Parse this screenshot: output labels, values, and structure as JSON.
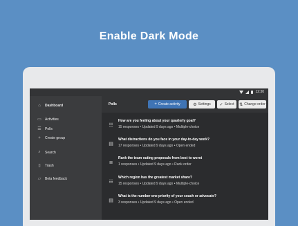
{
  "headline": "Enable Dark Mode",
  "status_bar": {
    "time": "12:30"
  },
  "sidebar": {
    "items": [
      {
        "label": "Dashboard",
        "icon": "home-icon"
      },
      {
        "label": "Activities",
        "icon": "folder-icon"
      },
      {
        "label": "Polls",
        "icon": "polls-icon"
      },
      {
        "label": "Create group",
        "icon": "plus-icon"
      },
      {
        "label": "Search",
        "icon": "search-icon"
      },
      {
        "label": "Trash",
        "icon": "trash-icon"
      },
      {
        "label": "Beta feedback",
        "icon": "feedback-icon"
      }
    ]
  },
  "toolbar": {
    "title": "Polls",
    "create_label": "Create activity",
    "settings_label": "Settings",
    "select_label": "Select",
    "change_order_label": "Change order"
  },
  "polls": [
    {
      "title": "How are you feeling about your quarterly goal?",
      "responses": "15 responses",
      "updated": "Updated 9 days ago",
      "type": "Multiple-choice",
      "icon": "multiple-choice-icon"
    },
    {
      "title": "What distractions do you face in your day-to-day work?",
      "responses": "17 responses",
      "updated": "Updated 9 days ago",
      "type": "Open ended",
      "icon": "open-ended-icon"
    },
    {
      "title": "Rank the team outing proposals from best to worst",
      "responses": "1 responses",
      "updated": "Updated 9 days ago",
      "type": "Rank order",
      "icon": "rank-order-icon"
    },
    {
      "title": "Which region has the greatest market share?",
      "responses": "15 responses",
      "updated": "Updated 9 days ago",
      "type": "Multiple-choice",
      "icon": "multiple-choice-icon"
    },
    {
      "title": "What is the number one priority of your coach or advocate?",
      "responses": "3 responses",
      "updated": "Updated 9 days ago",
      "type": "Open ended",
      "icon": "open-ended-icon"
    }
  ],
  "separator": "•"
}
